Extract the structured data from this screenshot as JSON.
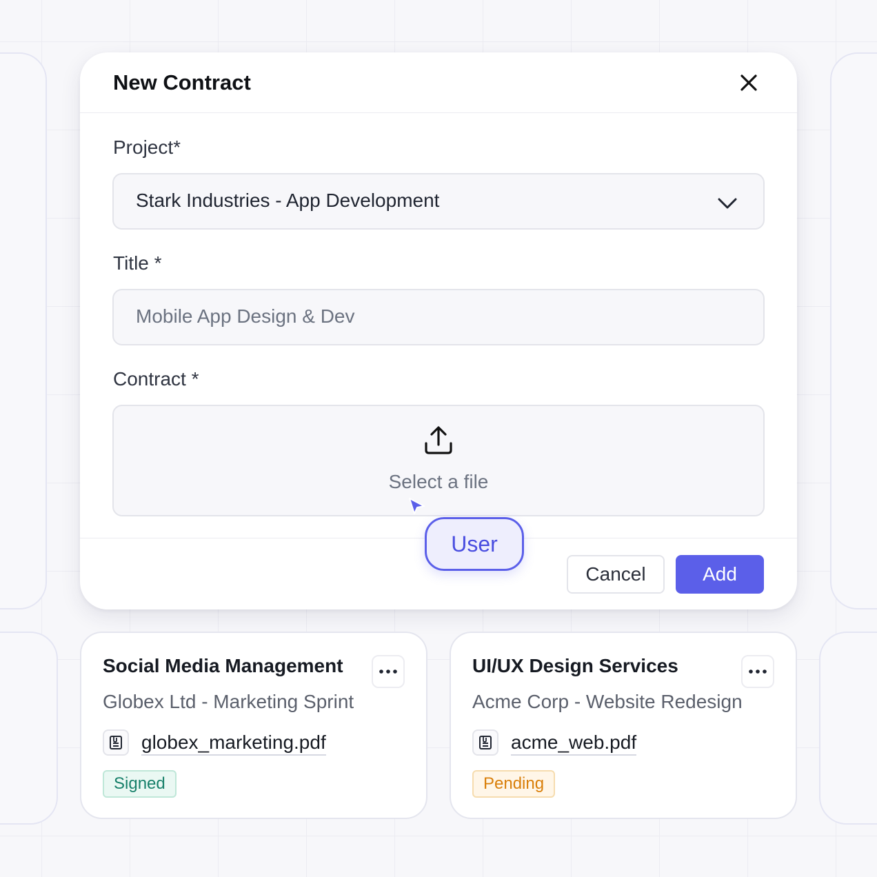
{
  "modal": {
    "title": "New Contract",
    "close_icon": "close-icon",
    "project": {
      "label": "Project*",
      "selected_value": "Stark Industries - App Development",
      "icon": "chevron-down-icon"
    },
    "title_field": {
      "label": "Title *",
      "placeholder": "Mobile App Design & Dev"
    },
    "contract": {
      "label": "Contract *",
      "upload_label": "Select a file",
      "icon": "upload-icon"
    },
    "footer": {
      "cancel_label": "Cancel",
      "add_label": "Add"
    }
  },
  "cursor": {
    "label": "User",
    "color": "#5b5fe9"
  },
  "cards": [
    {
      "title": "Social Media Management",
      "subtitle": "Globex Ltd - Marketing Sprint",
      "file": "globex_marketing.pdf",
      "status": "Signed",
      "status_color": "#17806a"
    },
    {
      "title": "UI/UX Design Services",
      "subtitle": "Acme Corp - Website Redesign",
      "file": "acme_web.pdf",
      "status": "Pending",
      "status_color": "#d97f0a"
    }
  ],
  "colors": {
    "accent": "#5b5fe9",
    "background": "#f7f7fa"
  }
}
